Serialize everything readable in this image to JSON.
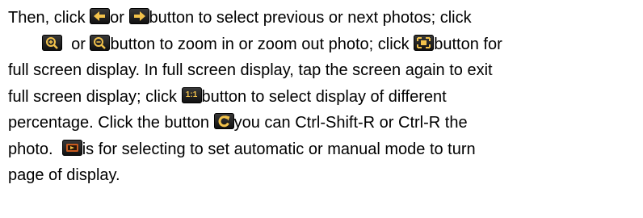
{
  "paragraph": {
    "line1": {
      "a": "Then, click",
      "b": "or",
      "c": "button to select previous or next photos; click"
    },
    "line2": {
      "a": "or",
      "b": "button to zoom in or zoom out photo; click",
      "c": "button for"
    },
    "line3": "full screen display. In full screen display, tap the screen again to exit",
    "line4": {
      "a": "full screen display; click",
      "b": "button to select display of different"
    },
    "line5": {
      "a": "percentage. Click the button",
      "b": "you can Ctrl-Shift-R or Ctrl-R the"
    },
    "line6": {
      "a": "photo.",
      "b": "is for selecting to set automatic or manual mode to turn"
    },
    "line7": "page of display."
  },
  "icons": {
    "previous": "arrow-left-icon",
    "next": "arrow-right-icon",
    "zoom_in": "zoom-in-icon",
    "zoom_out": "zoom-out-icon",
    "fullscreen": "fullscreen-icon",
    "ratio": "one-to-one-icon",
    "ratio_label": "1:1",
    "rotate": "rotate-icon",
    "slideshow": "slideshow-icon"
  },
  "colors": {
    "icon_bg": "#1e1e1e",
    "icon_glyph": "#f2c24b",
    "text": "#000000"
  }
}
